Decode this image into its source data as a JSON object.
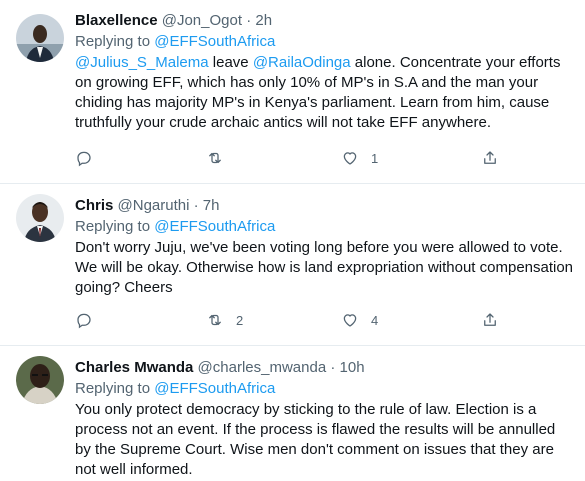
{
  "tweets": [
    {
      "name": "Blaxellence",
      "handle": "@Jon_Ogot",
      "sep": "·",
      "time": "2h",
      "replying_prefix": "Replying to ",
      "replying_to": "@EFFSouthAfrica",
      "body": {
        "mention1": "@Julius_S_Malema",
        "t1": " leave ",
        "mention2": "@RailaOdinga",
        "t2": "  alone.  Concentrate your efforts on growing EFF, which has only 10% of MP's in S.A and the man your chiding has majority MP's in Kenya's parliament. Learn from him,  cause truthfully your crude archaic antics will not take EFF anywhere."
      },
      "retweets": "",
      "likes": "1"
    },
    {
      "name": "Chris",
      "handle": "@Ngaruthi",
      "sep": "·",
      "time": "7h",
      "replying_prefix": "Replying to ",
      "replying_to": "@EFFSouthAfrica",
      "body": "Don't worry Juju, we've been voting long before you were allowed to vote. We will be okay. Otherwise how is land expropriation without compensation going? Cheers",
      "retweets": "2",
      "likes": "4"
    },
    {
      "name": "Charles Mwanda",
      "handle": "@charles_mwanda",
      "sep": "·",
      "time": "10h",
      "replying_prefix": "Replying to ",
      "replying_to": "@EFFSouthAfrica",
      "body": "You only protect democracy by sticking to the rule of law. Election is a process not an event. If the process is flawed the results will be annulled by the Supreme Court. Wise men don't comment on issues that they are not well informed."
    }
  ],
  "colors": {
    "text": "#0f1419",
    "muted": "#536471",
    "link": "#1d9bf0",
    "divider": "#e6ecf0"
  }
}
